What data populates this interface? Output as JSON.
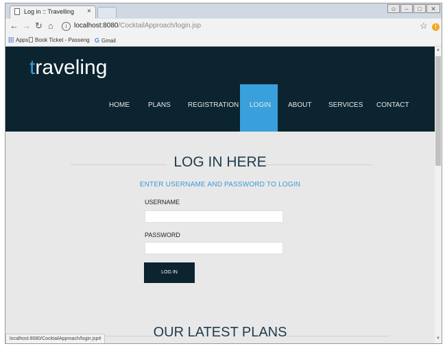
{
  "browser": {
    "tab_title": "Log in :: Travelling",
    "tab_close": "×",
    "url_host": "localhost:8080",
    "url_path": "/CocktailApproach/login.jsp",
    "bookmarks": [
      {
        "label": "Apps"
      },
      {
        "label": "Book Ticket - Passeng"
      },
      {
        "label": "Gmail"
      }
    ],
    "status_text": "localhost:8080/CocktailApproach/login.jsp#"
  },
  "site": {
    "logo_first": "t",
    "logo_rest": "raveling",
    "nav": [
      {
        "label": "HOME"
      },
      {
        "label": "PLANS"
      },
      {
        "label": "REGISTRATION"
      },
      {
        "label": "LOGIN",
        "active": true
      },
      {
        "label": "ABOUT"
      },
      {
        "label": "SERVICES"
      },
      {
        "label": "CONTACT"
      }
    ]
  },
  "login": {
    "heading": "LOG IN HERE",
    "subheading": "ENTER USERNAME AND PASSWORD TO LOGIN",
    "username_label": "USERNAME",
    "username_value": "",
    "password_label": "PASSWORD",
    "password_value": "",
    "button_label": "LOG IN"
  },
  "plans": {
    "heading": "OUR LATEST PLANS"
  },
  "colors": {
    "header_bg": "#0c2430",
    "accent": "#3aa0dc",
    "content_bg": "#e8e8e8"
  }
}
